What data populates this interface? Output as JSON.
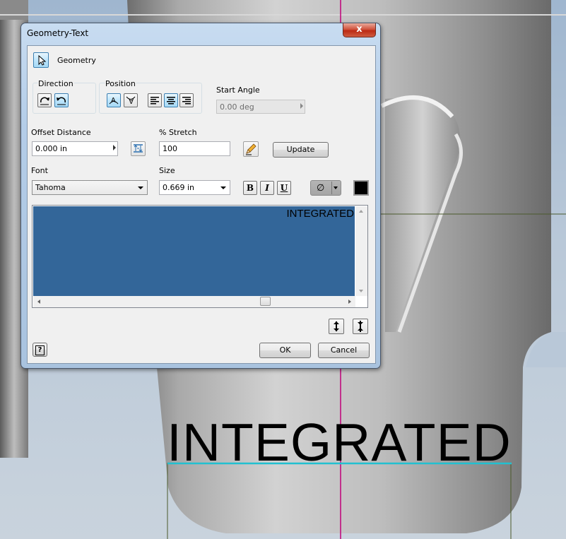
{
  "dialog": {
    "title": "Geometry-Text",
    "close_glyph": "x",
    "geometry_label": "Geometry",
    "direction_label": "Direction",
    "position_label": "Position",
    "start_angle_label": "Start Angle",
    "start_angle_value": "0.00 deg",
    "offset_distance_label": "Offset Distance",
    "offset_distance_value": "0.000 in",
    "stretch_label": "% Stretch",
    "stretch_value": "100",
    "update_label": "Update",
    "font_label": "Font",
    "font_value": "Tahoma",
    "size_label": "Size",
    "size_value": "0.669 in",
    "bold_label": "B",
    "italic_label": "I",
    "underline_label": "U",
    "symbol_glyph": "∅",
    "text_content": "INTEGRATED",
    "ok_label": "OK",
    "cancel_label": "Cancel",
    "help_glyph": "?"
  },
  "viewport": {
    "model_text": "INTEGRATED",
    "colors": {
      "text_area_bg": "#336699",
      "text_color_swatch": "#000000",
      "centerline": "#c0007a",
      "baseline": "#22c0d0"
    }
  }
}
